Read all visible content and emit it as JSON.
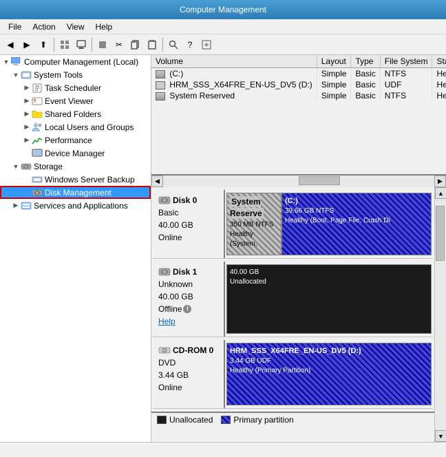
{
  "titleBar": {
    "title": "Computer Management"
  },
  "menuBar": {
    "items": [
      "File",
      "Action",
      "View",
      "Help"
    ]
  },
  "toolbar": {
    "buttons": [
      "◀",
      "▶",
      "⬆",
      "📋",
      "🖥",
      "◼",
      "✂",
      "📋",
      "📋",
      "🔍",
      "🔍",
      "📋"
    ]
  },
  "tree": {
    "root": {
      "label": "Computer Management (Local)",
      "icon": "💻"
    },
    "items": [
      {
        "id": "system-tools",
        "label": "System Tools",
        "icon": "🔧",
        "level": 1,
        "expanded": true
      },
      {
        "id": "task-scheduler",
        "label": "Task Scheduler",
        "icon": "📅",
        "level": 2
      },
      {
        "id": "event-viewer",
        "label": "Event Viewer",
        "icon": "📋",
        "level": 2
      },
      {
        "id": "shared-folders",
        "label": "Shared Folders",
        "icon": "📁",
        "level": 2
      },
      {
        "id": "local-users",
        "label": "Local Users and Groups",
        "icon": "👥",
        "level": 2
      },
      {
        "id": "performance",
        "label": "Performance",
        "icon": "📊",
        "level": 2
      },
      {
        "id": "device-manager",
        "label": "Device Manager",
        "icon": "🖥",
        "level": 2
      },
      {
        "id": "storage",
        "label": "Storage",
        "icon": "💾",
        "level": 1,
        "expanded": true
      },
      {
        "id": "windows-server-backup",
        "label": "Windows Server Backup",
        "icon": "💾",
        "level": 2
      },
      {
        "id": "disk-management",
        "label": "Disk Management",
        "icon": "💿",
        "level": 2,
        "selected": true
      },
      {
        "id": "services-applications",
        "label": "Services and Applications",
        "icon": "⚙",
        "level": 1
      }
    ]
  },
  "volumeTable": {
    "columns": [
      "Volume",
      "Layout",
      "Type",
      "File System",
      "Status"
    ],
    "rows": [
      {
        "name": "(C:)",
        "layout": "Simple",
        "type": "Basic",
        "fs": "NTFS",
        "status": "Healthy (B"
      },
      {
        "name": "HRM_SSS_X64FRE_EN-US_DV5 (D:)",
        "layout": "Simple",
        "type": "Basic",
        "fs": "UDF",
        "status": "Healthy ("
      },
      {
        "name": "System Reserved",
        "layout": "Simple",
        "type": "Basic",
        "fs": "NTFS",
        "status": "Healthy (S"
      }
    ]
  },
  "diskPanels": [
    {
      "id": "disk0",
      "name": "Disk 0",
      "type": "Basic",
      "size": "40.00 GB",
      "status": "Online",
      "partitions": [
        {
          "id": "system-reserve",
          "name": "System Reserve",
          "size": "350 MB NTFS",
          "health": "Healthy (System,",
          "type": "system"
        },
        {
          "id": "c-drive",
          "name": "(C:)",
          "size": "39.66 GB NTFS",
          "health": "Healthy (Boot, Page File, Crash Di",
          "type": "primary"
        }
      ]
    },
    {
      "id": "disk1",
      "name": "Disk 1",
      "type": "Unknown",
      "size": "40.00 GB",
      "status": "Offline",
      "helpText": "Help",
      "partitions": [
        {
          "id": "unallocated1",
          "name": "",
          "size": "40.00 GB",
          "health": "Unallocated",
          "type": "unallocated"
        }
      ]
    },
    {
      "id": "cdrom0",
      "name": "CD-ROM 0",
      "type": "DVD",
      "size": "3.44 GB",
      "status": "Online",
      "partitions": [
        {
          "id": "cdrom-part",
          "name": "HRM_SSS_X64FRE_EN-US_DV5 (D:)",
          "size": "3.44 GB UDF",
          "health": "Healthy (Primary Partition)",
          "type": "primary"
        }
      ]
    }
  ],
  "legend": {
    "items": [
      {
        "label": "Unallocated",
        "type": "unalloc"
      },
      {
        "label": "Primary partition",
        "type": "primary"
      }
    ]
  },
  "statusBar": {
    "text": ""
  }
}
